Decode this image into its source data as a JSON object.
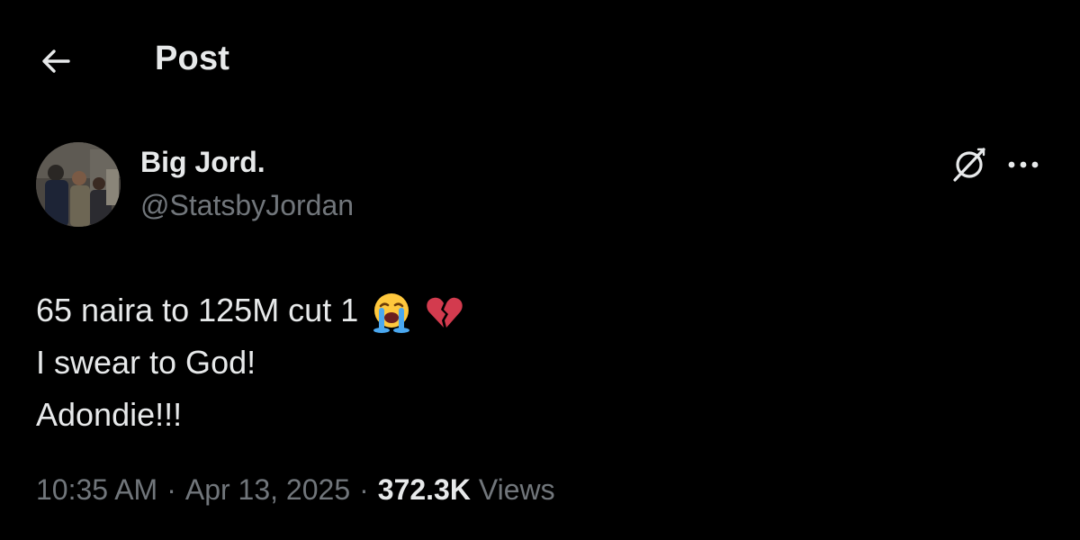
{
  "header": {
    "title": "Post",
    "back_icon": "arrow-left-icon"
  },
  "author": {
    "name": "Big Jord.",
    "handle": "@StatsbyJordan",
    "avatar_icon": "avatar-photo"
  },
  "actions": {
    "grok_icon": "grok-icon",
    "more_icon": "more-horizontal-icon"
  },
  "post": {
    "lines": [
      "65 naira to 125M cut 1",
      "I swear to God!",
      "Adondie!!!"
    ],
    "emojis": [
      "loudly-crying-face-icon",
      "broken-heart-icon"
    ]
  },
  "meta": {
    "time": "10:35 AM",
    "separator": "·",
    "date": "Apr 13, 2025",
    "views_count": "372.3K",
    "views_label": "Views"
  },
  "colors": {
    "background": "#000000",
    "primary_text": "#e7e9ea",
    "secondary_text": "#71767b"
  }
}
